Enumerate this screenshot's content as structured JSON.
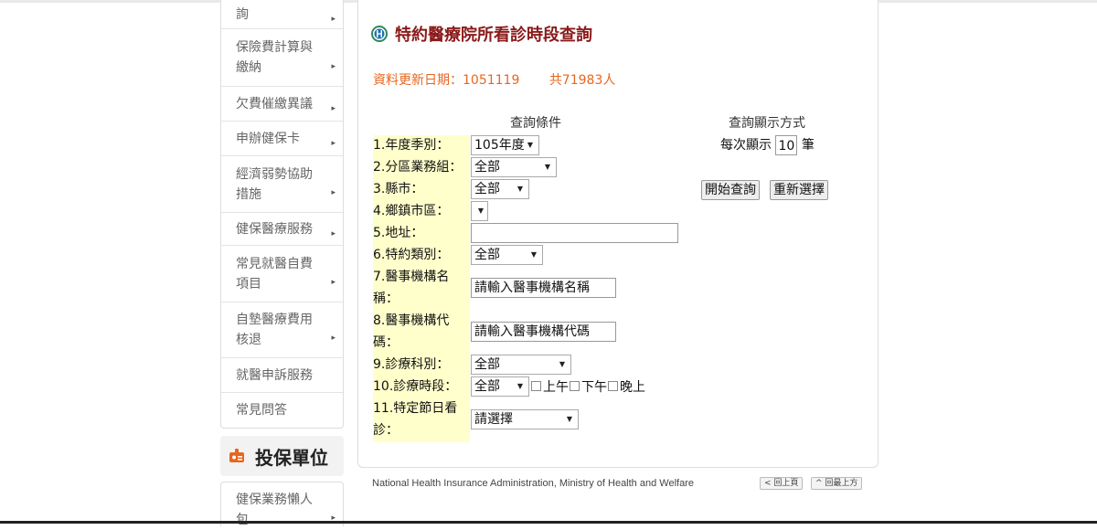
{
  "sidebar": {
    "items": [
      {
        "label": "詢"
      },
      {
        "label": "保險費計算與繳納"
      },
      {
        "label": "欠費催繳異議"
      },
      {
        "label": "申辦健保卡"
      },
      {
        "label": "經濟弱勢協助措施"
      },
      {
        "label": "健保醫療服務"
      },
      {
        "label": "常見就醫自費項目"
      },
      {
        "label": "自墊醫療費用核退"
      },
      {
        "label": "就醫申訴服務"
      },
      {
        "label": "常見問答"
      }
    ],
    "section_title": "投保單位",
    "section_items": [
      {
        "label": "健保業務懶人包"
      }
    ],
    "arrow": "▸"
  },
  "main": {
    "title": "特約醫療院所看診時段查詢",
    "update_label": "資料更新日期：1051119",
    "count_label": "共71983人"
  },
  "form": {
    "criteria_header": "查詢條件",
    "display_header": "查詢顯示方式",
    "fields": {
      "year": {
        "label": "1.年度季別：",
        "value": "105年度"
      },
      "region": {
        "label": "2.分區業務組：",
        "value": "全部"
      },
      "county": {
        "label": "3.縣市：",
        "value": "全部"
      },
      "town": {
        "label": "4.鄉鎮市區：",
        "value": ""
      },
      "address": {
        "label": "5.地址：",
        "value": ""
      },
      "contract_type": {
        "label": "6.特約類別：",
        "value": "全部"
      },
      "org_name": {
        "label": "7.醫事機構名稱：",
        "placeholder": "請輸入醫事機構名稱"
      },
      "org_code": {
        "label": "8.醫事機構代碼：",
        "placeholder": "請輸入醫事機構代碼"
      },
      "department": {
        "label": "9.診療科別：",
        "value": "全部"
      },
      "period": {
        "label": "10.診療時段：",
        "value": "全部",
        "options": [
          "上午",
          "下午",
          "晚上"
        ]
      },
      "holiday": {
        "label": "11.特定節日看診：",
        "value": "請選擇"
      }
    },
    "per_page": {
      "prefix": "每次顯示",
      "value": "10",
      "suffix": "筆"
    },
    "search_button": "開始查詢",
    "reset_button": "重新選擇"
  },
  "footer": {
    "text": "National Health Insurance Administration, Ministry of Health and Welfare",
    "back_button": "< 回上頁",
    "top_button": "^ 回最上方"
  },
  "colors": {
    "title": "#8b1a1a",
    "update": "#e8661f",
    "label_bg": "#ffffcc",
    "section_icon": "#e8661f"
  }
}
